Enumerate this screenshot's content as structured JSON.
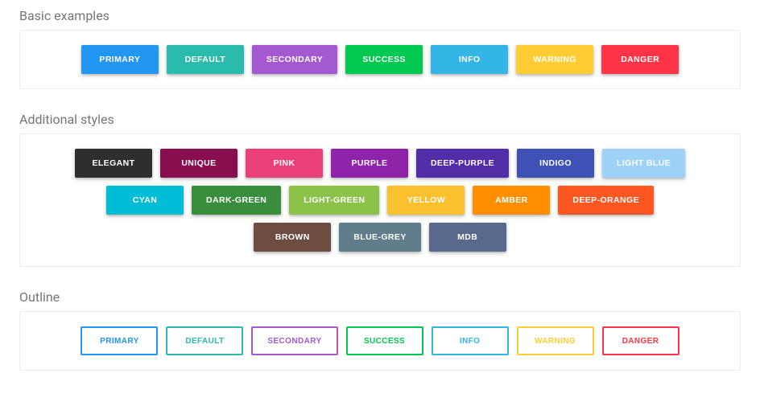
{
  "sections": {
    "basic": {
      "title": "Basic examples",
      "buttons": [
        {
          "label": "PRIMARY",
          "bg": "#2196f3"
        },
        {
          "label": "DEFAULT",
          "bg": "#2bbbad"
        },
        {
          "label": "SECONDARY",
          "bg": "#a459d1"
        },
        {
          "label": "SUCCESS",
          "bg": "#00c851"
        },
        {
          "label": "INFO",
          "bg": "#33b5e5"
        },
        {
          "label": "WARNING",
          "bg": "#ffcc33"
        },
        {
          "label": "DANGER",
          "bg": "#ff3547"
        }
      ]
    },
    "additional": {
      "title": "Additional styles",
      "buttons": [
        {
          "label": "ELEGANT",
          "bg": "#2e2e2e"
        },
        {
          "label": "UNIQUE",
          "bg": "#880e4f"
        },
        {
          "label": "PINK",
          "bg": "#ec407a"
        },
        {
          "label": "PURPLE",
          "bg": "#8e24aa"
        },
        {
          "label": "DEEP-PURPLE",
          "bg": "#512da8"
        },
        {
          "label": "INDIGO",
          "bg": "#3f51b5"
        },
        {
          "label": "LIGHT BLUE",
          "bg": "#9fd2f8"
        },
        {
          "label": "CYAN",
          "bg": "#00bcd4"
        },
        {
          "label": "DARK-GREEN",
          "bg": "#388e3c"
        },
        {
          "label": "LIGHT-GREEN",
          "bg": "#8bc34a"
        },
        {
          "label": "YELLOW",
          "bg": "#fbc02d"
        },
        {
          "label": "AMBER",
          "bg": "#ff8f00"
        },
        {
          "label": "DEEP-ORANGE",
          "bg": "#ff5722"
        },
        {
          "label": "BROWN",
          "bg": "#6d4c41"
        },
        {
          "label": "BLUE-GREY",
          "bg": "#607d8b"
        },
        {
          "label": "MDB",
          "bg": "#59698d"
        }
      ]
    },
    "outline": {
      "title": "Outline",
      "buttons": [
        {
          "label": "PRIMARY",
          "color": "#2196f3"
        },
        {
          "label": "DEFAULT",
          "color": "#2bbbad"
        },
        {
          "label": "SECONDARY",
          "color": "#a459d1"
        },
        {
          "label": "SUCCESS",
          "color": "#00c851"
        },
        {
          "label": "INFO",
          "color": "#33b5e5"
        },
        {
          "label": "WARNING",
          "color": "#ffcc33"
        },
        {
          "label": "DANGER",
          "color": "#ff3547"
        }
      ]
    }
  }
}
